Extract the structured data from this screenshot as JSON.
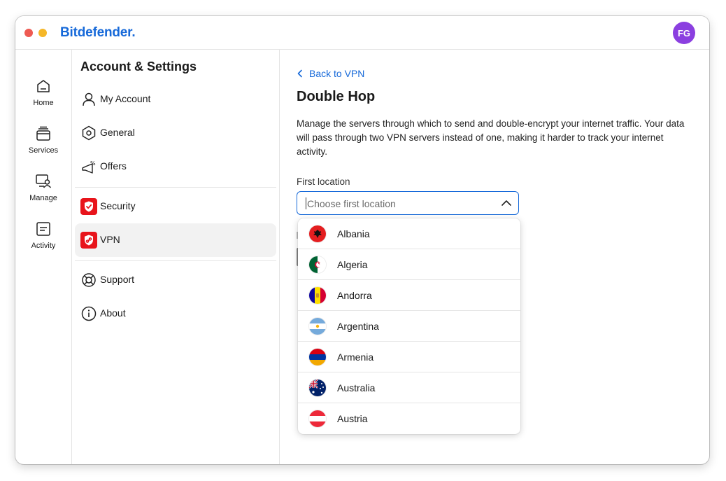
{
  "app": {
    "brand": "Bitdefender",
    "brand_dot": ".",
    "avatar_initials": "FG"
  },
  "leftnav": [
    {
      "label": "Home",
      "icon": "home-icon"
    },
    {
      "label": "Services",
      "icon": "services-icon"
    },
    {
      "label": "Manage",
      "icon": "manage-icon"
    },
    {
      "label": "Activity",
      "icon": "activity-icon"
    }
  ],
  "settings": {
    "title": "Account & Settings",
    "items": [
      {
        "label": "My Account",
        "icon": "user-icon"
      },
      {
        "label": "General",
        "icon": "hexagon-gear-icon"
      },
      {
        "label": "Offers",
        "icon": "megaphone-icon"
      },
      {
        "label": "Security",
        "icon": "shield-icon"
      },
      {
        "label": "VPN",
        "icon": "vpn-shield-icon",
        "active": true
      },
      {
        "label": "Support",
        "icon": "lifebuoy-icon"
      },
      {
        "label": "About",
        "icon": "info-icon"
      }
    ]
  },
  "main": {
    "back_label": "Back to VPN",
    "title": "Double Hop",
    "description": "Manage the servers through which to send and double-encrypt your internet traffic. Your data will pass through two VPN servers instead of one, making it harder to track your internet activity.",
    "first_location_label": "First location",
    "first_location_placeholder": "Choose first location",
    "options": [
      {
        "label": "Albania",
        "flag": "albania-flag-icon"
      },
      {
        "label": "Algeria",
        "flag": "algeria-flag-icon"
      },
      {
        "label": "Andorra",
        "flag": "andorra-flag-icon"
      },
      {
        "label": "Argentina",
        "flag": "argentina-flag-icon"
      },
      {
        "label": "Armenia",
        "flag": "armenia-flag-icon"
      },
      {
        "label": "Australia",
        "flag": "australia-flag-icon"
      },
      {
        "label": "Austria",
        "flag": "austria-flag-icon"
      }
    ]
  },
  "colors": {
    "accent": "#1669d9",
    "security_red": "#e8141b",
    "avatar": "#8b3fe0"
  }
}
